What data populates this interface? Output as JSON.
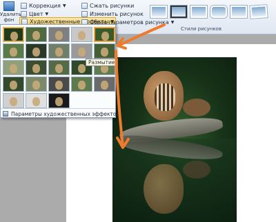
{
  "ribbon": {
    "remove_background": "Удалить фон",
    "correction": "Коррекция",
    "color": "Цвет",
    "artistic_effects": "Художественные эффекты",
    "compress_pictures": "Сжать рисунки",
    "change_picture": "Изменить рисунок",
    "reset_picture": "Сброс параметров рисунка",
    "picture_styles_group": "Стили рисунков"
  },
  "effects_menu": {
    "tooltip": "Размытие",
    "options_link": "Параметры художественных эффектов...",
    "grid_columns": 5,
    "grid_rows": 5,
    "cells": [
      {
        "bg": "#203a1c",
        "state": "selected"
      },
      {
        "bg": "#4f6a3f",
        "state": ""
      },
      {
        "bg": "#7f7f7f",
        "state": ""
      },
      {
        "bg": "#c8c8c8",
        "state": ""
      },
      {
        "bg": "#3a5a2a",
        "state": "hover"
      },
      {
        "bg": "#5a7a48",
        "state": ""
      },
      {
        "bg": "#2a3a28",
        "state": ""
      },
      {
        "bg": "#6f7f6a",
        "state": ""
      },
      {
        "bg": "#9a9a9a",
        "state": ""
      },
      {
        "bg": "#445e35",
        "state": ""
      },
      {
        "bg": "#8fa07a",
        "state": ""
      },
      {
        "bg": "#3c4e32",
        "state": ""
      },
      {
        "bg": "#556b48",
        "state": ""
      },
      {
        "bg": "#2f4a2a",
        "state": ""
      },
      {
        "bg": "#607a52",
        "state": ""
      },
      {
        "bg": "#334a2c",
        "state": ""
      },
      {
        "bg": "#7a8a6a",
        "state": ""
      },
      {
        "bg": "#4a4a4a",
        "state": ""
      },
      {
        "bg": "#5d7a4e",
        "state": ""
      },
      {
        "bg": "#6a6a6a",
        "state": ""
      },
      {
        "bg": "#d0d0d0",
        "state": ""
      },
      {
        "bg": "#e0e0e0",
        "state": ""
      },
      {
        "bg": "#1a1a1a",
        "state": ""
      }
    ]
  },
  "colors": {
    "accent_arrow": "#ee7b2b",
    "selection": "#e9b243"
  }
}
